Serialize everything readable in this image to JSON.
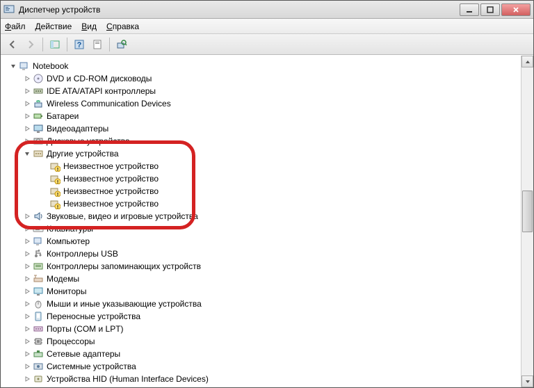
{
  "window": {
    "title": "Диспетчер устройств"
  },
  "menu": {
    "file": "Файл",
    "action": "Действие",
    "view": "Вид",
    "help": "Справка"
  },
  "tree": {
    "root": "Notebook",
    "items": [
      {
        "label": "DVD и CD-ROM дисководы",
        "icon": "disc"
      },
      {
        "label": "IDE ATA/ATAPI контроллеры",
        "icon": "ide"
      },
      {
        "label": "Wireless Communication Devices",
        "icon": "wifi"
      },
      {
        "label": "Батареи",
        "icon": "battery"
      },
      {
        "label": "Видеоадаптеры",
        "icon": "display"
      },
      {
        "label": "Дисковые устройства",
        "icon": "disk"
      },
      {
        "label": "Другие устройства",
        "icon": "other",
        "expanded": true,
        "children": [
          {
            "label": "Неизвестное устройство"
          },
          {
            "label": "Неизвестное устройство"
          },
          {
            "label": "Неизвестное устройство"
          },
          {
            "label": "Неизвестное устройство"
          }
        ]
      },
      {
        "label": "Звуковые, видео и игровые устройства",
        "icon": "sound"
      },
      {
        "label": "Клавиатуры",
        "icon": "keyboard"
      },
      {
        "label": "Компьютер",
        "icon": "computer"
      },
      {
        "label": "Контроллеры USB",
        "icon": "usb"
      },
      {
        "label": "Контроллеры запоминающих устройств",
        "icon": "storage"
      },
      {
        "label": "Модемы",
        "icon": "modem"
      },
      {
        "label": "Мониторы",
        "icon": "monitor"
      },
      {
        "label": "Мыши и иные указывающие устройства",
        "icon": "mouse"
      },
      {
        "label": "Переносные устройства",
        "icon": "portable"
      },
      {
        "label": "Порты (COM и LPT)",
        "icon": "port"
      },
      {
        "label": "Процессоры",
        "icon": "cpu"
      },
      {
        "label": "Сетевые адаптеры",
        "icon": "network"
      },
      {
        "label": "Системные устройства",
        "icon": "system"
      },
      {
        "label": "Устройства HID (Human Interface Devices)",
        "icon": "hid"
      }
    ]
  }
}
